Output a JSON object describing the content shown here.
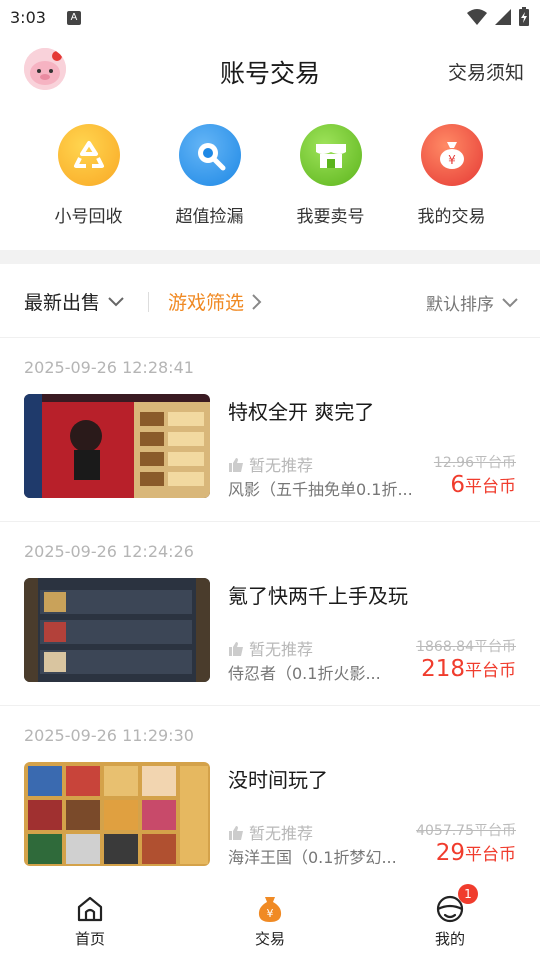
{
  "status_bar": {
    "time": "3:03",
    "app_badge": "A"
  },
  "header": {
    "title": "账号交易",
    "notice": "交易须知"
  },
  "quick_actions": [
    {
      "label": "小号回收",
      "icon": "recycle-icon",
      "color": "#f9a825"
    },
    {
      "label": "超值捡漏",
      "icon": "magnifier-icon",
      "color": "#2196f3"
    },
    {
      "label": "我要卖号",
      "icon": "shop-icon",
      "color": "#7ed321"
    },
    {
      "label": "我的交易",
      "icon": "money-bag-icon",
      "color": "#f4511e"
    }
  ],
  "filters": {
    "latest": "最新出售",
    "game_filter": "游戏筛选",
    "sort": "默认排序"
  },
  "listings": [
    {
      "time": "2025-09-26 12:28:41",
      "title": "特权全开 爽完了",
      "recommendation": "暂无推荐",
      "game": "风影（五千抽免单0.1折...",
      "original_price": "12.96平台币",
      "price": "6",
      "price_unit": "平台币"
    },
    {
      "time": "2025-09-26 12:24:26",
      "title": "氪了快两千上手及玩",
      "recommendation": "暂无推荐",
      "game": "侍忍者（0.1折火影...",
      "original_price": "1868.84平台币",
      "price": "218",
      "price_unit": "平台币"
    },
    {
      "time": "2025-09-26 11:29:30",
      "title": "没时间玩了",
      "recommendation": "暂无推荐",
      "game": "海洋王国（0.1折梦幻...",
      "original_price": "4057.75平台币",
      "price": "29",
      "price_unit": "平台币"
    }
  ],
  "bottom_nav": [
    {
      "label": "首页",
      "icon": "home-icon"
    },
    {
      "label": "交易",
      "icon": "trade-bag-icon",
      "active": true
    },
    {
      "label": "我的",
      "icon": "profile-icon",
      "badge": "1"
    }
  ],
  "colors": {
    "accent": "#f08a24",
    "price": "#f03c2d"
  }
}
